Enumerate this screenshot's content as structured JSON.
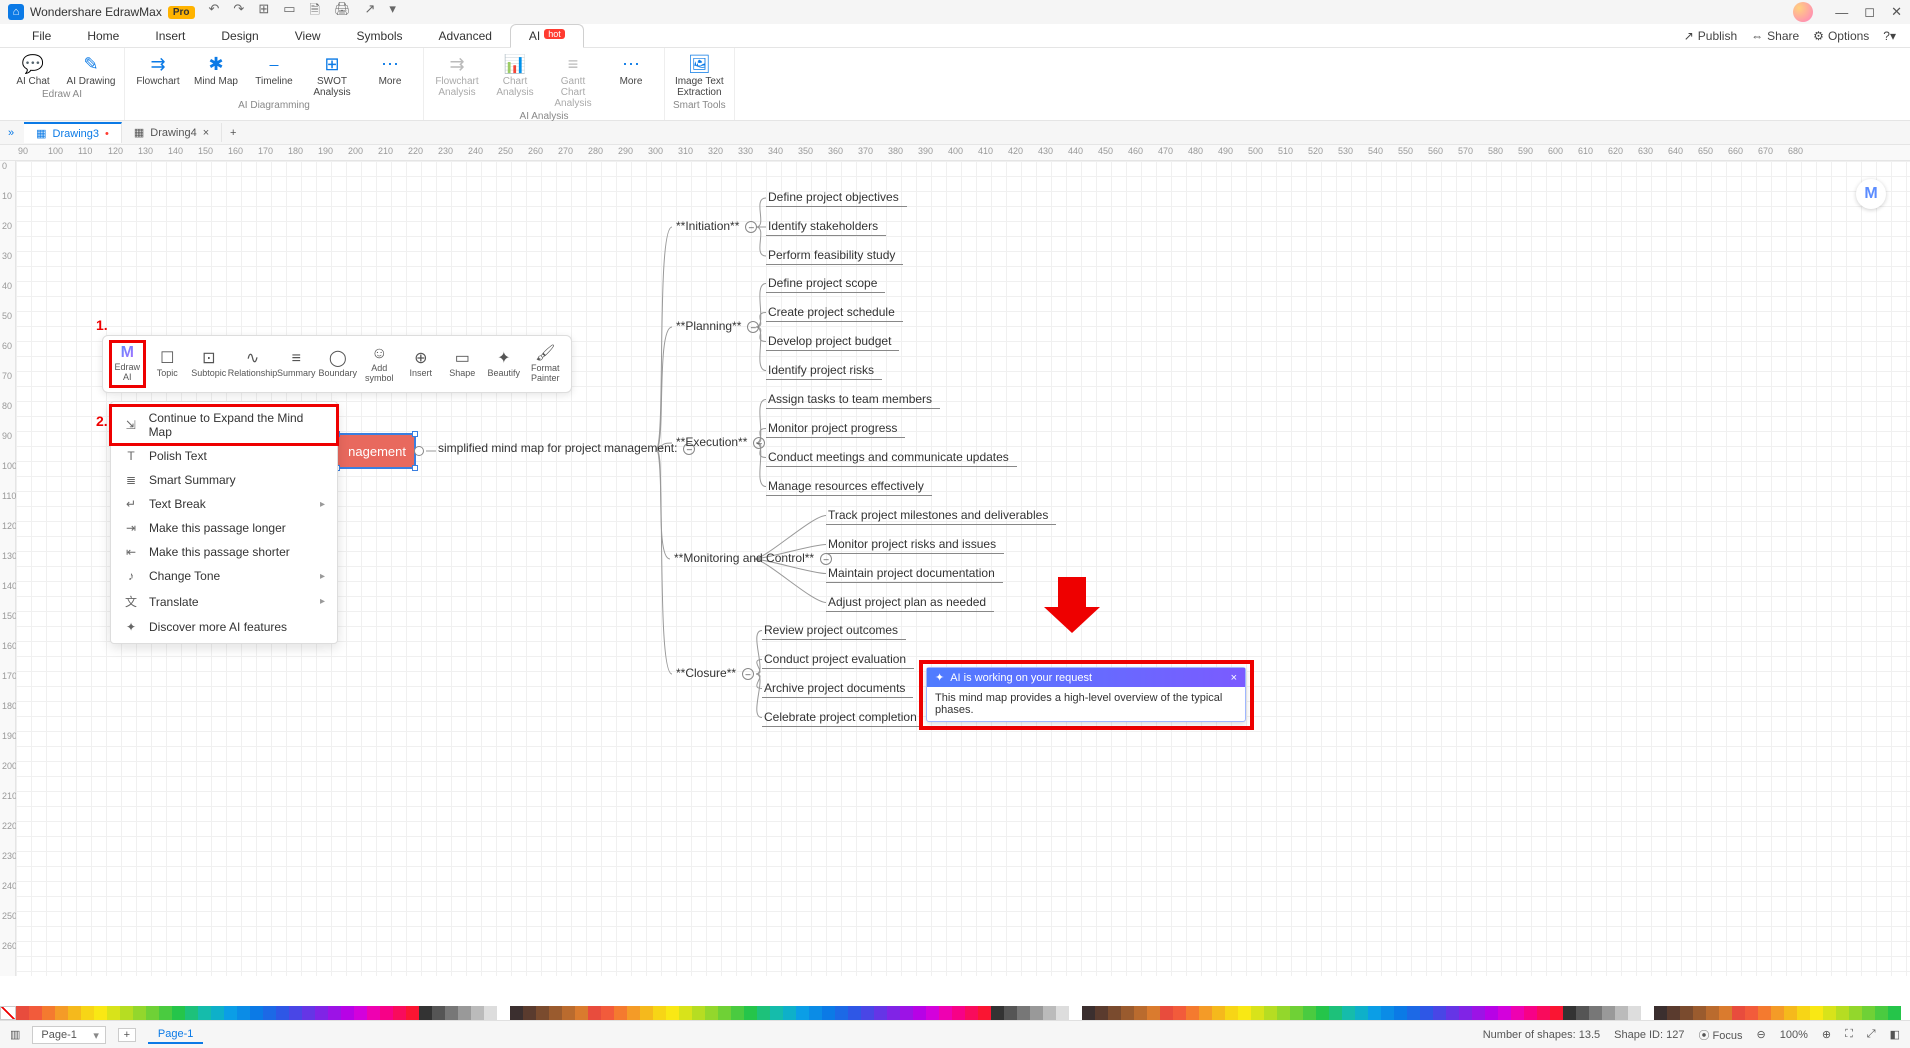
{
  "titlebar": {
    "app_name": "Wondershare EdrawMax",
    "pro_badge": "Pro"
  },
  "menubar": {
    "items": [
      "File",
      "Home",
      "Insert",
      "Design",
      "View",
      "Symbols",
      "Advanced"
    ],
    "ai_tab": "AI",
    "hot_badge": "hot",
    "right": {
      "publish": "Publish",
      "share": "Share",
      "options": "Options"
    }
  },
  "ribbon": {
    "groups": [
      {
        "label": "Edraw AI",
        "buttons": [
          {
            "name": "ai-chat",
            "label": "AI Chat"
          },
          {
            "name": "ai-drawing",
            "label": "AI Drawing"
          }
        ]
      },
      {
        "label": "AI Diagramming",
        "buttons": [
          {
            "name": "flowchart",
            "label": "Flowchart"
          },
          {
            "name": "mind-map",
            "label": "Mind Map"
          },
          {
            "name": "timeline",
            "label": "Timeline"
          },
          {
            "name": "swot",
            "label": "SWOT Analysis"
          },
          {
            "name": "more-diag",
            "label": "More"
          }
        ]
      },
      {
        "label": "AI Analysis",
        "buttons": [
          {
            "name": "flowchart-analysis",
            "label": "Flowchart Analysis",
            "dim": true
          },
          {
            "name": "chart-analysis",
            "label": "Chart Analysis",
            "dim": true
          },
          {
            "name": "gantt-analysis",
            "label": "Gantt Chart Analysis",
            "dim": true
          },
          {
            "name": "more-analysis",
            "label": "More"
          }
        ]
      },
      {
        "label": "Smart Tools",
        "buttons": [
          {
            "name": "image-text-extraction",
            "label": "Image Text Extraction"
          }
        ]
      }
    ]
  },
  "doctabs": {
    "tabs": [
      {
        "name": "Drawing3",
        "active": true,
        "dirty": true
      },
      {
        "name": "Drawing4",
        "active": false,
        "dirty": false
      }
    ]
  },
  "float_toolbar": {
    "buttons": [
      {
        "name": "edraw-ai",
        "label": "Edraw AI"
      },
      {
        "name": "topic",
        "label": "Topic"
      },
      {
        "name": "subtopic",
        "label": "Subtopic"
      },
      {
        "name": "relationship",
        "label": "Relationship"
      },
      {
        "name": "summary",
        "label": "Summary"
      },
      {
        "name": "boundary",
        "label": "Boundary"
      },
      {
        "name": "add-symbol",
        "label": "Add symbol"
      },
      {
        "name": "insert",
        "label": "Insert"
      },
      {
        "name": "shape",
        "label": "Shape"
      },
      {
        "name": "beautify",
        "label": "Beautify"
      },
      {
        "name": "format-painter",
        "label": "Format Painter"
      }
    ]
  },
  "markers": {
    "one": "1.",
    "two": "2."
  },
  "context_menu": {
    "items": [
      {
        "name": "continue-expand",
        "label": "Continue to Expand the Mind Map",
        "highlight": true
      },
      {
        "name": "polish-text",
        "label": "Polish Text"
      },
      {
        "name": "smart-summary",
        "label": "Smart Summary"
      },
      {
        "name": "text-break",
        "label": "Text Break",
        "submenu": true
      },
      {
        "name": "make-longer",
        "label": "Make this passage longer"
      },
      {
        "name": "make-shorter",
        "label": "Make this passage shorter"
      },
      {
        "name": "change-tone",
        "label": "Change Tone",
        "submenu": true
      },
      {
        "name": "translate",
        "label": "Translate",
        "submenu": true
      },
      {
        "name": "discover-more",
        "label": "Discover more AI features"
      }
    ]
  },
  "mindmap": {
    "root": "nagement",
    "subroot": "simplified mind map for project management:",
    "branches": [
      {
        "title": "**Initiation**",
        "leaves": [
          "Define project objectives",
          "Identify stakeholders",
          "Perform feasibility study"
        ]
      },
      {
        "title": "**Planning**",
        "leaves": [
          "Define project scope",
          "Create project schedule",
          "Develop project budget",
          "Identify project risks"
        ]
      },
      {
        "title": "**Execution**",
        "leaves": [
          "Assign tasks to team members",
          "Monitor project progress",
          "Conduct meetings and communicate updates",
          "Manage resources effectively"
        ]
      },
      {
        "title": "**Monitoring and Control**",
        "leaves": [
          "Track project milestones and deliverables",
          "Monitor project risks and issues",
          "Maintain project documentation",
          "Adjust project plan as needed"
        ]
      },
      {
        "title": "**Closure**",
        "leaves": [
          "Review project outcomes",
          "Conduct project evaluation",
          "Archive project documents",
          "Celebrate project completion"
        ]
      }
    ]
  },
  "ai_popup": {
    "header": "AI is working on your request",
    "body": "This mind map provides a high-level overview of the typical phases."
  },
  "palette_colors": [
    "#e84c3d",
    "#f25b3b",
    "#f47a2f",
    "#f49b27",
    "#f5b91c",
    "#f7d516",
    "#f9e814",
    "#d8e31a",
    "#b6dd22",
    "#93d72c",
    "#6fd136",
    "#4acb40",
    "#25c54a",
    "#1dc17a",
    "#15bcab",
    "#0eb0c9",
    "#0b9ee6",
    "#0b8ce6",
    "#0b7ae6",
    "#1c69e6",
    "#2e57e6",
    "#4946e6",
    "#6535e6",
    "#8024e6",
    "#9c13e6",
    "#b702e6",
    "#d301dc",
    "#ee01b1",
    "#f70187",
    "#f90b5c",
    "#fa1532",
    "#333333",
    "#555555",
    "#777777",
    "#999999",
    "#bbbbbb",
    "#dddddd",
    "#ffffff",
    "#3b2f2f",
    "#5a3b2e",
    "#7a4b2e",
    "#9a5b2e",
    "#ba6b2e",
    "#da7b2e"
  ],
  "statusbar": {
    "page_dd": "Page-1",
    "page_tab": "Page-1",
    "shapes": "Number of shapes: 13.5",
    "shape_id": "Shape ID: 127",
    "focus": "Focus",
    "zoom": "100%"
  }
}
